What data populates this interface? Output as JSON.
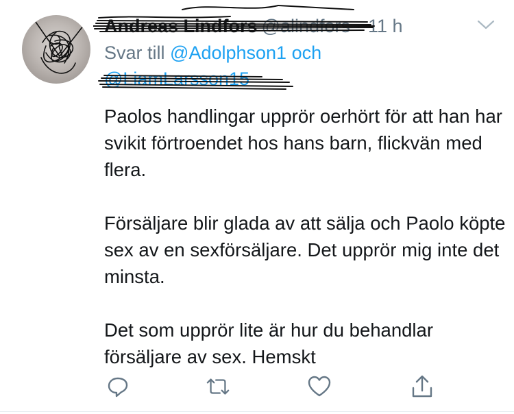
{
  "tweet": {
    "author": {
      "display_name": "Andreas Lindfors",
      "handle": "@alindfors",
      "avatar_icon": "profile-avatar"
    },
    "separator": "·",
    "time": "11 h",
    "reply_to": {
      "prefix": "Svar till",
      "user1": "@Adolphson1",
      "conjunction": "och",
      "user2": "@LiamLarsson15"
    },
    "body": [
      "Paolos handlingar upprör oerhört för att han har svikit förtroendet hos hans barn, flickvän med flera.",
      "Försäljare blir glada av att sälja och Paolo köpte sex av en sexförsäljare. Det upprör mig inte det minsta.",
      "Det som upprör lite är hur du behandlar försäljare av sex. Hemskt"
    ]
  },
  "actions": {
    "reply_icon": "reply-icon",
    "retweet_icon": "retweet-icon",
    "like_icon": "like-icon",
    "share_icon": "share-icon",
    "icon_color": "#657786"
  }
}
